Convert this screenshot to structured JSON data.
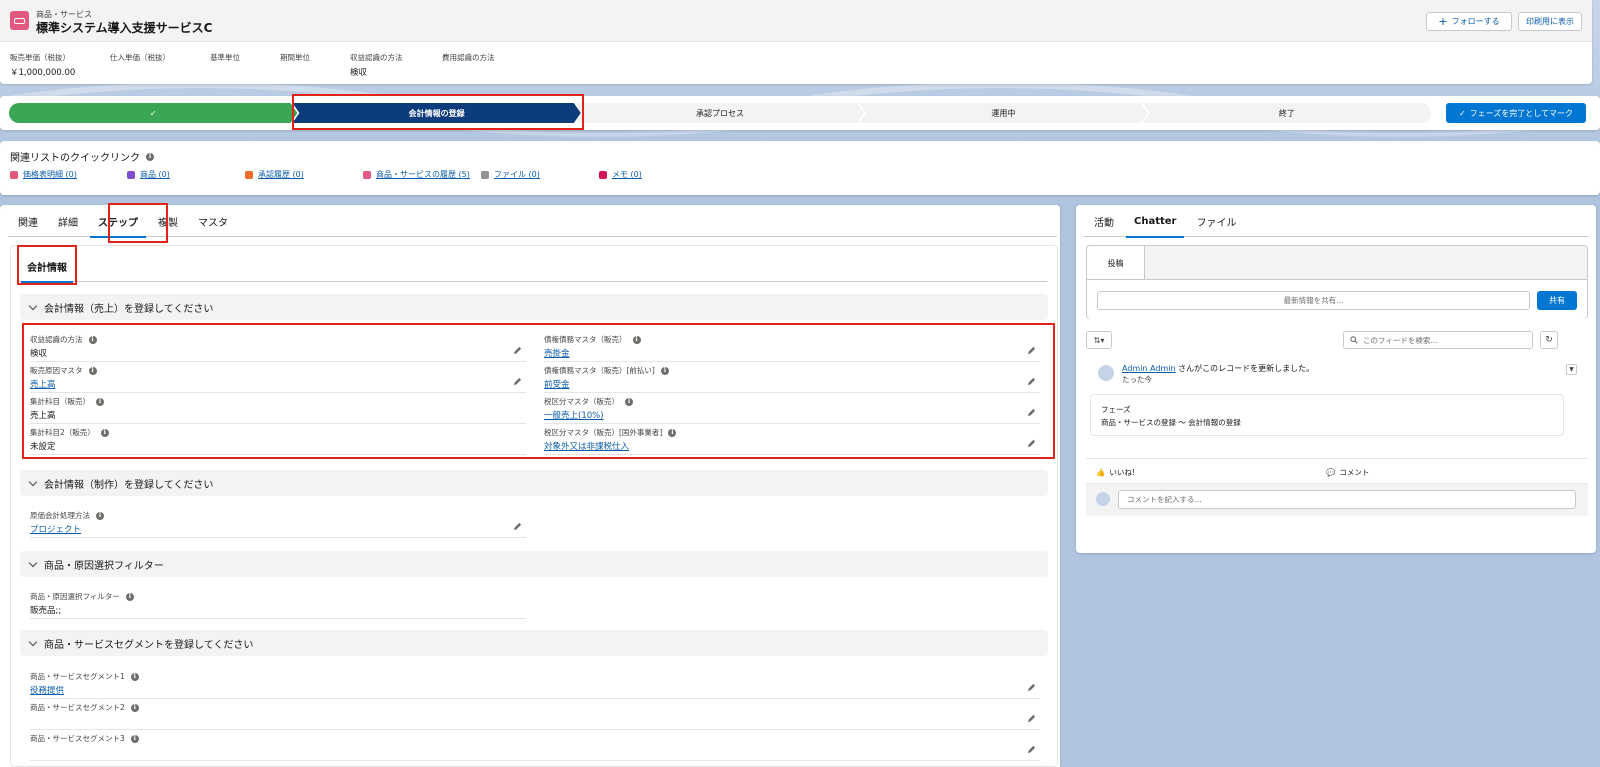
{
  "header": {
    "object_type": "商品・サービス",
    "record_name": "標準システム導入支援サービスC",
    "follow_label": "フォローする",
    "print_label": "印刷用に表示",
    "fields": [
      {
        "label": "販売単価（税抜）",
        "value": "￥1,000,000.00"
      },
      {
        "label": "仕入単価（税抜）",
        "value": ""
      },
      {
        "label": "基準単位",
        "value": ""
      },
      {
        "label": "期間単位",
        "value": ""
      },
      {
        "label": "収益認識の方法",
        "value": "検収"
      },
      {
        "label": "費用認識の方法",
        "value": ""
      }
    ]
  },
  "path": {
    "stages": [
      "✓",
      "会計情報の登録",
      "承認プロセス",
      "運用中",
      "終了"
    ],
    "mark_button": "フェーズを完了としてマーク"
  },
  "quick_links": {
    "title": "関連リストのクイックリンク",
    "items": [
      {
        "label": "価格表明細 (0)",
        "color": "#e3587f"
      },
      {
        "label": "商品 (0)",
        "color": "#7f4dd0"
      },
      {
        "label": "承認履歴 (0)",
        "color": "#f06e28"
      },
      {
        "label": "商品・サービスの履歴 (5)",
        "color": "#e3587f"
      },
      {
        "label": "ファイル (0)",
        "color": "#939393"
      },
      {
        "label": "メモ (0)",
        "color": "#d4145a"
      }
    ]
  },
  "main": {
    "tabs": [
      "関連",
      "詳細",
      "ステップ",
      "複製",
      "マスタ"
    ],
    "subtab": "会計情報",
    "sections": {
      "s1": "会計情報（売上）を登録してください",
      "s2": "会計情報（制作）を登録してください",
      "s3": "商品・原因選択フィルター",
      "s4": "商品・サービスセグメントを登録してください"
    },
    "fields": {
      "f1": {
        "label": "収益認識の方法",
        "value": "検収"
      },
      "f2": {
        "label": "販売原因マスタ",
        "value": "売上高"
      },
      "f3": {
        "label": "集計科目（販売）",
        "value": "売上高"
      },
      "f4": {
        "label": "集計科目2（販売）",
        "value": "未設定"
      },
      "f5": {
        "label": "債権債務マスタ（販売）",
        "value": "売掛金"
      },
      "f6": {
        "label": "債権債務マスタ（販売）[前払い]",
        "value": "前受金"
      },
      "f7": {
        "label": "税区分マスタ（販売）",
        "value": "一般売上(10%)"
      },
      "f8": {
        "label": "税区分マスタ（販売）[国外事業者]",
        "value": "対象外又は非課税仕入"
      },
      "f9": {
        "label": "原価会計処理方法",
        "value": "プロジェクト"
      },
      "f10": {
        "label": "商品・原因選択フィルター",
        "value": "販売品;;"
      },
      "f11": {
        "label": "商品・サービスセグメント1",
        "value": "役務提供"
      },
      "f12": {
        "label": "商品・サービスセグメント2",
        "value": ""
      },
      "f13": {
        "label": "商品・サービスセグメント3",
        "value": ""
      }
    }
  },
  "side": {
    "tabs": [
      "活動",
      "Chatter",
      "ファイル"
    ],
    "publisher_tab": "投稿",
    "share_placeholder": "最新情報を共有...",
    "share_button": "共有",
    "search_placeholder": "このフィードを検索...",
    "feed": {
      "author": "Admin Admin",
      "action": " さんがこのレコードを更新しました。",
      "time": "たった今",
      "field": "フェーズ",
      "change": "商品・サービスの登録 〜 会計情報の登録"
    },
    "like": "いいね!",
    "comment": "コメント",
    "comment_placeholder": "コメントを記入する..."
  },
  "colors": {
    "brand": "#0176d3",
    "path_complete": "#3ba755",
    "path_current": "#0d3c7d",
    "highlight": "#e2231a"
  }
}
